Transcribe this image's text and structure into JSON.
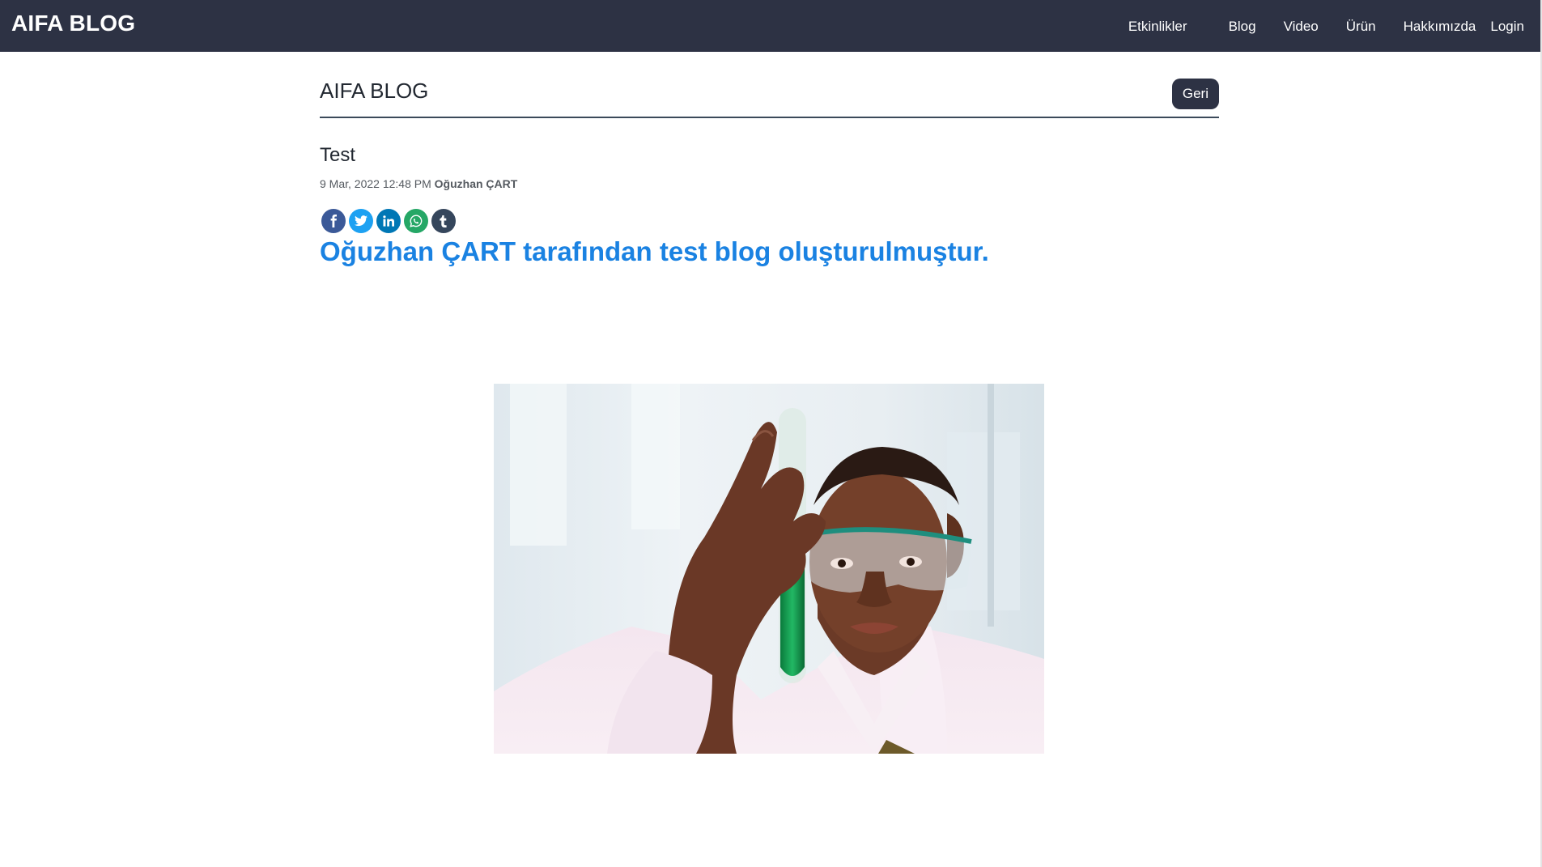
{
  "navbar": {
    "brand": "AIFA BLOG",
    "links": [
      "Etkinlikler",
      "Blog",
      "Video",
      "Ürün",
      "Hakkımızda",
      "Login"
    ],
    "background": "#2d3244"
  },
  "page": {
    "header_title": "AIFA BLOG",
    "back_label": "Geri"
  },
  "post": {
    "title": "Test",
    "date": "9 Mar, 2022 12:48 PM",
    "author": "Oğuzhan ÇART",
    "headline": "Oğuzhan ÇART tarafından test blog oluşturulmuştur.",
    "headline_color": "#1a82e2"
  },
  "share": {
    "icons": [
      {
        "name": "facebook-icon",
        "color": "#3b5998"
      },
      {
        "name": "twitter-icon",
        "color": "#1da1f2"
      },
      {
        "name": "linkedin-icon",
        "color": "#0077b5"
      },
      {
        "name": "whatsapp-icon",
        "color": "#25a766"
      },
      {
        "name": "tumblr-icon",
        "color": "#35465c"
      }
    ]
  }
}
